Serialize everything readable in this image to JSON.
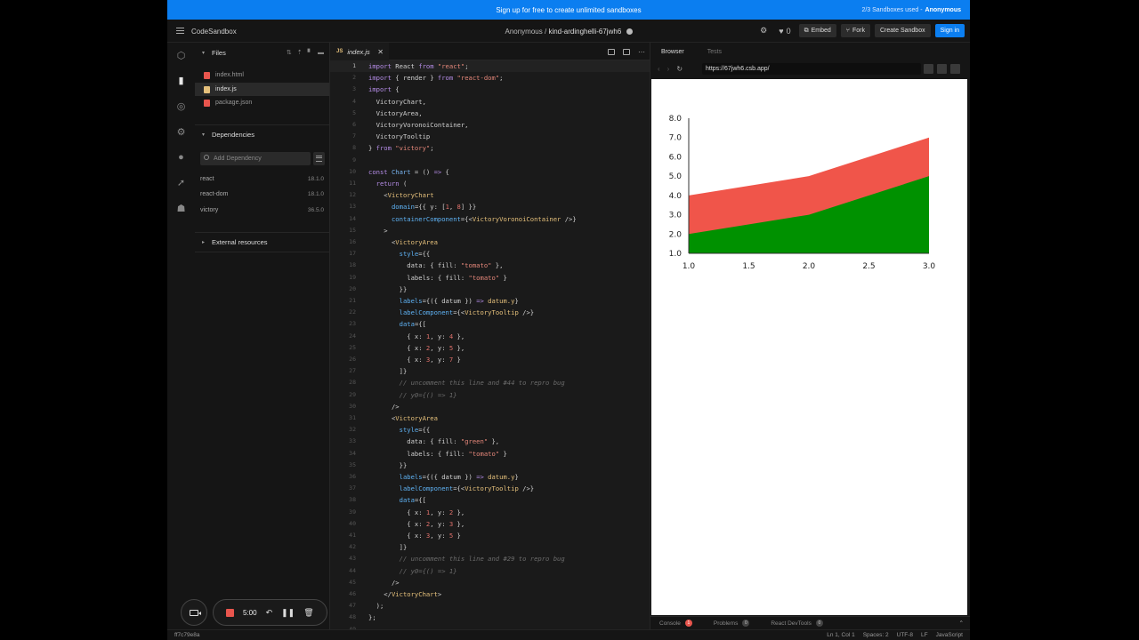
{
  "banner": {
    "text": "Sign up for free to create unlimited sandboxes",
    "usage": "2/3 Sandboxes used -",
    "user": "Anonymous"
  },
  "header": {
    "brand": "CodeSandbox",
    "owner": "Anonymous /",
    "sandbox_name": "kind-ardinghelli-67jwh6",
    "likes": "0",
    "embed": "Embed",
    "fork": "Fork",
    "create": "Create Sandbox",
    "signin": "Sign in"
  },
  "sidebar": {
    "files_title": "Files",
    "files": [
      {
        "name": "index.html",
        "icon_color": "#e8554d"
      },
      {
        "name": "index.js",
        "icon_color": "#e5c07b"
      },
      {
        "name": "package.json",
        "icon_color": "#e8554d"
      }
    ],
    "dependencies_title": "Dependencies",
    "add_dependency_placeholder": "Add Dependency",
    "dependencies": [
      {
        "name": "react",
        "version": "18.1.0"
      },
      {
        "name": "react-dom",
        "version": "18.1.0"
      },
      {
        "name": "victory",
        "version": "36.5.0"
      }
    ],
    "external_title": "External resources"
  },
  "recorder": {
    "time": "5:00"
  },
  "editor": {
    "tab": "index.js",
    "line_numbers": [
      "1",
      "2",
      "3",
      "4",
      "5",
      "6",
      "7",
      "8",
      "9",
      "10",
      "11",
      "12",
      "13",
      "14",
      "15",
      "16",
      "17",
      "18",
      "19",
      "20",
      "21",
      "22",
      "23",
      "24",
      "25",
      "26",
      "27",
      "28",
      "29",
      "30",
      "31",
      "32",
      "33",
      "34",
      "35",
      "36",
      "37",
      "38",
      "39",
      "40",
      "41",
      "42",
      "43",
      "44",
      "45",
      "46",
      "47",
      "48",
      "49"
    ]
  },
  "preview": {
    "tabs": [
      "Browser",
      "Tests"
    ],
    "url": "https://67jwh6.csb.app/",
    "bottom_tabs": [
      {
        "label": "Console",
        "count": "1"
      },
      {
        "label": "Problems",
        "count": "0"
      },
      {
        "label": "React DevTools",
        "count": "0"
      }
    ]
  },
  "chart_data": {
    "type": "area",
    "x": [
      1,
      2,
      3
    ],
    "series": [
      {
        "values": [
          4,
          5,
          7
        ],
        "color": "#f0554a"
      },
      {
        "values": [
          2,
          3,
          5
        ],
        "color": "#009100"
      }
    ],
    "xticks": [
      "1.0",
      "1.5",
      "2.0",
      "2.5",
      "3.0"
    ],
    "yticks": [
      "1.0",
      "2.0",
      "3.0",
      "4.0",
      "5.0",
      "6.0",
      "7.0",
      "8.0"
    ],
    "xlim": [
      1,
      3
    ],
    "ylim": [
      1,
      8
    ]
  },
  "status": {
    "commit": "ff7c79e8a",
    "cursor": "Ln 1, Col 1",
    "spaces": "Spaces: 2",
    "encoding": "UTF-8",
    "eol": "LF",
    "language": "JavaScript"
  }
}
